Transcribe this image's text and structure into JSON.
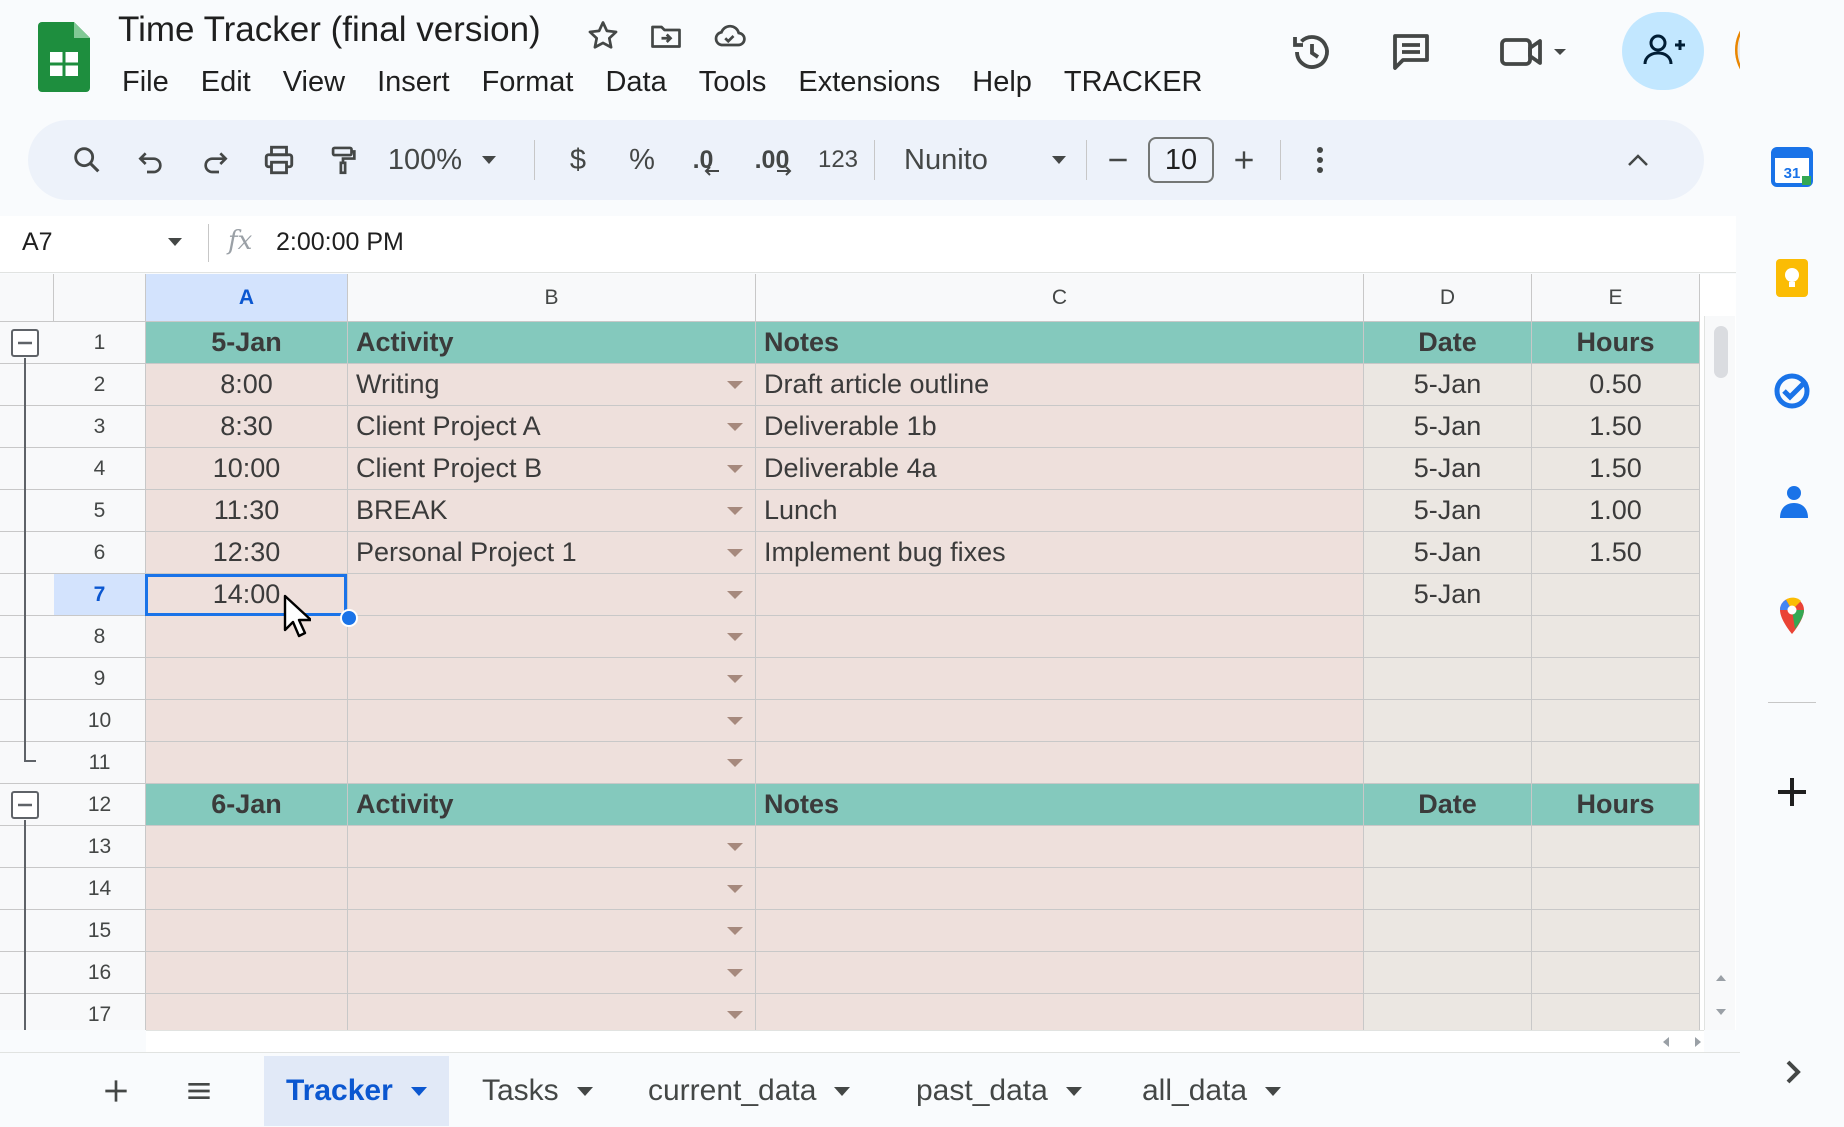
{
  "app": {
    "title": "Time Tracker (final version)",
    "menu": [
      "File",
      "Edit",
      "View",
      "Insert",
      "Format",
      "Data",
      "Tools",
      "Extensions",
      "Help",
      "TRACKER"
    ]
  },
  "toolbar": {
    "zoom": "100%",
    "currency": "$",
    "percent": "%",
    "dec_decrease": ".0",
    "dec_increase": ".00",
    "number_format": "123",
    "font": "Nunito",
    "font_size": "10"
  },
  "formula_bar": {
    "cell_ref": "A7",
    "fx": "fx",
    "value": "2:00:00 PM"
  },
  "grid": {
    "columns": [
      "A",
      "B",
      "C",
      "D",
      "E"
    ],
    "rows": [
      {
        "n": "1",
        "a": "5-Jan",
        "b": "Activity",
        "c": "Notes",
        "d": "Date",
        "e": "Hours",
        "type": "header"
      },
      {
        "n": "2",
        "a": "8:00",
        "b": "Writing",
        "c": "Draft article outline",
        "d": "5-Jan",
        "e": "0.50",
        "type": "body"
      },
      {
        "n": "3",
        "a": "8:30",
        "b": "Client Project A",
        "c": "Deliverable 1b",
        "d": "5-Jan",
        "e": "1.50",
        "type": "body"
      },
      {
        "n": "4",
        "a": "10:00",
        "b": "Client Project B",
        "c": "Deliverable 4a",
        "d": "5-Jan",
        "e": "1.50",
        "type": "body"
      },
      {
        "n": "5",
        "a": "11:30",
        "b": "BREAK",
        "c": "Lunch",
        "d": "5-Jan",
        "e": "1.00",
        "type": "body"
      },
      {
        "n": "6",
        "a": "12:30",
        "b": "Personal Project 1",
        "c": "Implement bug fixes",
        "d": "5-Jan",
        "e": "1.50",
        "type": "body"
      },
      {
        "n": "7",
        "a": "14:00",
        "b": "",
        "c": "",
        "d": "5-Jan",
        "e": "",
        "type": "body"
      },
      {
        "n": "8",
        "a": "",
        "b": "",
        "c": "",
        "d": "",
        "e": "",
        "type": "body"
      },
      {
        "n": "9",
        "a": "",
        "b": "",
        "c": "",
        "d": "",
        "e": "",
        "type": "body"
      },
      {
        "n": "10",
        "a": "",
        "b": "",
        "c": "",
        "d": "",
        "e": "",
        "type": "body"
      },
      {
        "n": "11",
        "a": "",
        "b": "",
        "c": "",
        "d": "",
        "e": "",
        "type": "body"
      },
      {
        "n": "12",
        "a": "6-Jan",
        "b": "Activity",
        "c": "Notes",
        "d": "Date",
        "e": "Hours",
        "type": "header"
      },
      {
        "n": "13",
        "a": "",
        "b": "",
        "c": "",
        "d": "",
        "e": "",
        "type": "body"
      },
      {
        "n": "14",
        "a": "",
        "b": "",
        "c": "",
        "d": "",
        "e": "",
        "type": "body"
      },
      {
        "n": "15",
        "a": "",
        "b": "",
        "c": "",
        "d": "",
        "e": "",
        "type": "body"
      },
      {
        "n": "16",
        "a": "",
        "b": "",
        "c": "",
        "d": "",
        "e": "",
        "type": "body"
      },
      {
        "n": "17",
        "a": "",
        "b": "",
        "c": "",
        "d": "",
        "e": "",
        "type": "body"
      }
    ],
    "selected_cell": "A7"
  },
  "tabs": [
    "Tracker",
    "Tasks",
    "current_data",
    "past_data",
    "all_data"
  ],
  "active_tab": "Tracker",
  "side_panel": {
    "calendar_day": "31"
  },
  "colors": {
    "header_fill": "#84c9bd",
    "body_fill": "#eee0dc",
    "selection": "#1a73e8",
    "share_button": "#c2e7ff",
    "sheets_green": "#1e8e3e"
  }
}
